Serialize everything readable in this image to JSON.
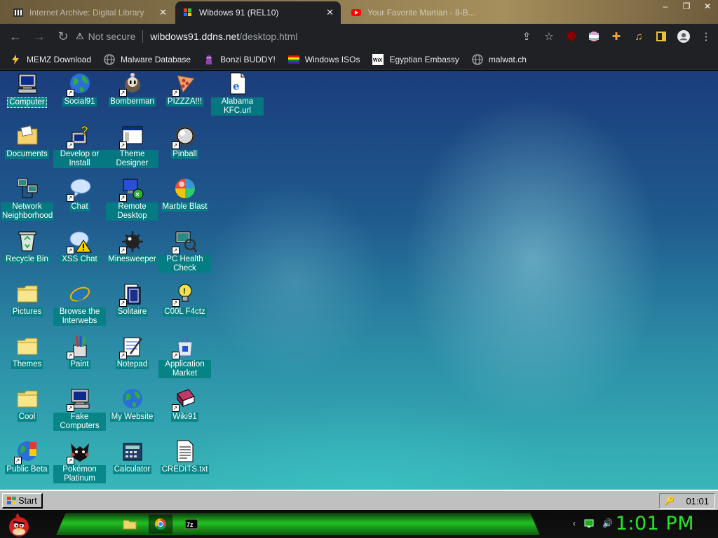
{
  "browser": {
    "tabs": [
      {
        "title": "Internet Archive: Digital Library",
        "active": false
      },
      {
        "title": "Wibdows 91 (REL10)",
        "active": true
      },
      {
        "title": "Your Favorite Martian - 8-B...",
        "active": false
      }
    ],
    "security_label": "Not secure",
    "url_host": "wibdows91.ddns.net",
    "url_path": "/desktop.html",
    "bookmarks": [
      {
        "label": "MEMZ Download",
        "icon": "bolt-icon"
      },
      {
        "label": "Malware Database",
        "icon": "globe-icon"
      },
      {
        "label": "Bonzi BUDDY!",
        "icon": "bonzi-icon"
      },
      {
        "label": "Windows ISOs",
        "icon": "rainbow-flag-icon"
      },
      {
        "label": "Egyptian Embassy",
        "icon": "wix-icon"
      },
      {
        "label": "malwat.ch",
        "icon": "globe-icon"
      }
    ]
  },
  "desktop": {
    "icons": [
      {
        "label": "Computer",
        "icon": "computer-icon",
        "shortcut": false,
        "selected": true
      },
      {
        "label": "Social91",
        "icon": "globe-icon",
        "shortcut": true
      },
      {
        "label": "Bomberman",
        "icon": "bomberman-icon",
        "shortcut": true
      },
      {
        "label": "PIZZZA!!!",
        "icon": "pizza-icon",
        "shortcut": true
      },
      {
        "label": "Alabama KFC.url",
        "icon": "ie-page-icon",
        "shortcut": false
      },
      {
        "label": "Documents",
        "icon": "folder-docs-icon",
        "shortcut": false
      },
      {
        "label": "Develop or Install",
        "icon": "setup-icon",
        "shortcut": true
      },
      {
        "label": "Theme Designer",
        "icon": "window-icon",
        "shortcut": true
      },
      {
        "label": "Pinball",
        "icon": "pinball-icon",
        "shortcut": true
      },
      {
        "label": "Network Neighborhood",
        "icon": "network-icon",
        "shortcut": false
      },
      {
        "label": "Chat",
        "icon": "chat-bubble-icon",
        "shortcut": true
      },
      {
        "label": "Remote Desktop",
        "icon": "remote-desktop-icon",
        "shortcut": true
      },
      {
        "label": "Marble Blast",
        "icon": "marble-icon",
        "shortcut": false
      },
      {
        "label": "Recycle Bin",
        "icon": "recycle-bin-icon",
        "shortcut": false
      },
      {
        "label": "XSS Chat",
        "icon": "chat-warning-icon",
        "shortcut": true
      },
      {
        "label": "Minesweeper",
        "icon": "mine-icon",
        "shortcut": true
      },
      {
        "label": "PC Health Check",
        "icon": "health-check-icon",
        "shortcut": true
      },
      {
        "label": "Pictures",
        "icon": "folder-icon",
        "shortcut": false
      },
      {
        "label": "Browse the Interwebs",
        "icon": "ie-logo-icon",
        "shortcut": false
      },
      {
        "label": "Solitaire",
        "icon": "cards-icon",
        "shortcut": true
      },
      {
        "label": "C00L F4ctz",
        "icon": "lightbulb-icon",
        "shortcut": true
      },
      {
        "label": "Themes",
        "icon": "folder-icon",
        "shortcut": false
      },
      {
        "label": "Paint",
        "icon": "paint-icon",
        "shortcut": true
      },
      {
        "label": "Notepad",
        "icon": "notepad-icon",
        "shortcut": true
      },
      {
        "label": "Application Market",
        "icon": "market-bag-icon",
        "shortcut": true
      },
      {
        "label": "Cool",
        "icon": "folder-icon",
        "shortcut": false
      },
      {
        "label": "Fake Computers",
        "icon": "computer-icon",
        "shortcut": true
      },
      {
        "label": "My Website",
        "icon": "globe-icon",
        "shortcut": false
      },
      {
        "label": "Wiki91",
        "icon": "book-icon",
        "shortcut": true
      },
      {
        "label": "Public Beta",
        "icon": "beta-globe-icon",
        "shortcut": true
      },
      {
        "label": "Pokémon Platinum",
        "icon": "pokemon-icon",
        "shortcut": true
      },
      {
        "label": "Calculator",
        "icon": "calculator-icon",
        "shortcut": false
      },
      {
        "label": "CREDITS.txt",
        "icon": "text-file-icon",
        "shortcut": false
      }
    ]
  },
  "win95_taskbar": {
    "start_label": "Start",
    "clock": "01:01"
  },
  "host_taskbar": {
    "clock": "1:01 PM",
    "pinned": [
      "folder-icon",
      "chrome-icon",
      "7zip-icon"
    ]
  },
  "colors": {
    "label_bg": "#008080",
    "host_clock": "#27e627",
    "taskbar_gray": "#c0c0c0"
  }
}
